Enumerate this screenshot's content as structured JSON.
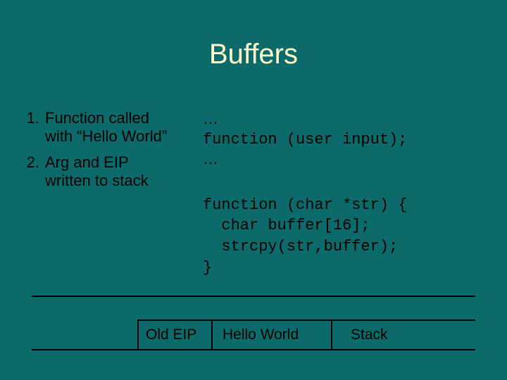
{
  "title": "Buffers",
  "steps": [
    {
      "num": "1.",
      "text_a": "Function called",
      "text_b": "with “Hello World”"
    },
    {
      "num": "2.",
      "text_a": "Arg and EIP",
      "text_b": "written to stack"
    }
  ],
  "code_top": {
    "l1": "…",
    "l2": "function (user input);",
    "l3": "…"
  },
  "code_fn": {
    "l1": "function (char *str) {",
    "l2": "  char buffer[16];",
    "l3": "  strcpy(str,buffer);",
    "l4": "}"
  },
  "stack": {
    "old_eip": "Old EIP",
    "arg": "Hello World",
    "label": "Stack"
  }
}
